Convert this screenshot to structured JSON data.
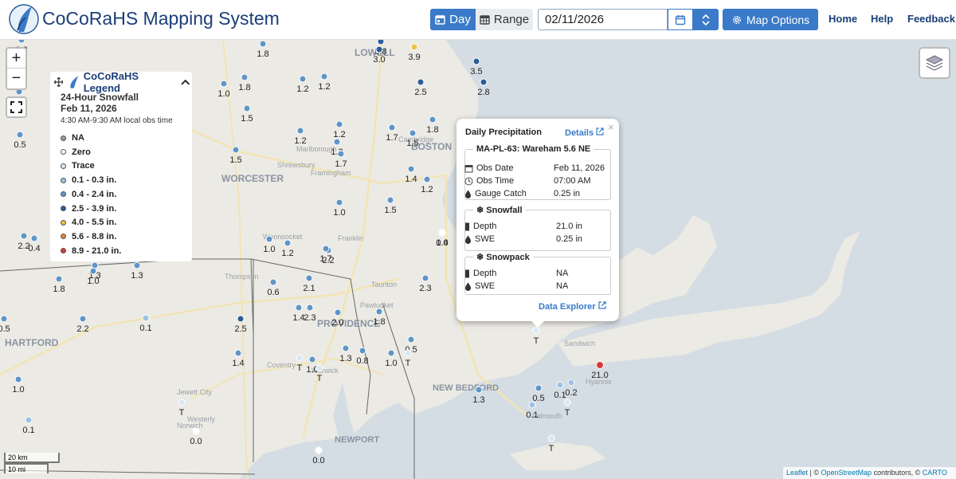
{
  "header": {
    "app_title": "CoCoRaHS Mapping System",
    "day_label": "Day",
    "range_label": "Range",
    "date_value": "02/11/2026",
    "map_options_label": "Map Options",
    "nav": [
      "Home",
      "Help",
      "Feedback"
    ]
  },
  "legend": {
    "title": "CoCoRaHS Legend",
    "subtitle": "24-Hour Snowfall",
    "date": "Feb 11, 2026",
    "obs_time": "4:30 AM-9:30 AM local obs time",
    "items": [
      {
        "label": "NA",
        "color": "#9a9a9a"
      },
      {
        "label": "Zero",
        "color": "#ffffff"
      },
      {
        "label": "Trace",
        "color": "#d9e8f5"
      },
      {
        "label": "0.1 - 0.3 in.",
        "color": "#9cc3e6"
      },
      {
        "label": "0.4 - 2.4 in.",
        "color": "#5f95c8"
      },
      {
        "label": "2.5 - 3.9 in.",
        "color": "#2a5d9a"
      },
      {
        "label": "4.0 - 5.5 in.",
        "color": "#e8c448"
      },
      {
        "label": "5.6 - 8.8 in.",
        "color": "#e08a3a"
      },
      {
        "label": "8.9 - 21.0 in.",
        "color": "#d93838"
      }
    ]
  },
  "popup": {
    "title": "Daily Precipitation",
    "details_label": "Details",
    "station": "MA-PL-63: Wareham 5.6 NE",
    "obs_date_label": "Obs Date",
    "obs_date": "Feb 11, 2026",
    "obs_time_label": "Obs Time",
    "obs_time": "07:00 AM",
    "gauge_label": "Gauge Catch",
    "gauge_catch": "0.25 in",
    "snowfall_title": "Snowfall",
    "snowfall_depth_label": "Depth",
    "snowfall_depth": "21.0 in",
    "snowfall_swe_label": "SWE",
    "snowfall_swe": "0.25 in",
    "snowpack_title": "Snowpack",
    "snowpack_depth_label": "Depth",
    "snowpack_depth": "NA",
    "snowpack_swe_label": "SWE",
    "snowpack_swe": "NA",
    "explorer_label": "Data Explorer"
  },
  "place_labels": [
    "LOWELL",
    "BOSTON",
    "WORCESTER",
    "PROVIDENCE",
    "HARTFORD",
    "NEW BEDFORD",
    "NEWPORT",
    "Framingham",
    "Marlborough",
    "Shrewsbury",
    "Franklin",
    "Thompson",
    "Coventry",
    "Warwick",
    "Westerly",
    "Norwich",
    "Jewett City",
    "Sandwich",
    "Hyannis",
    "Falmouth",
    "Plymouth",
    "Cambridge",
    "Taunton",
    "Woonsocket",
    "Pawtucket"
  ],
  "stations": [
    {
      "value": "1.8",
      "color": "#5f95c8"
    },
    {
      "value": "2.3",
      "color": "#5f95c8"
    },
    {
      "value": "3.8",
      "color": "#2a5d9a"
    },
    {
      "value": "3.0",
      "color": "#2a5d9a"
    },
    {
      "value": "3.9",
      "color": "#e8c448"
    },
    {
      "value": "3.5",
      "color": "#2a5d9a"
    },
    {
      "value": "2.5",
      "color": "#2a5d9a"
    },
    {
      "value": "2.8",
      "color": "#2a5d9a"
    },
    {
      "value": "1.0",
      "color": "#5f95c8"
    },
    {
      "value": "1.8",
      "color": "#5f95c8"
    },
    {
      "value": "1.2",
      "color": "#5f95c8"
    },
    {
      "value": "1.2",
      "color": "#5f95c8"
    },
    {
      "value": "1.5",
      "color": "#5f95c8"
    },
    {
      "value": "1.5",
      "color": "#5f95c8"
    },
    {
      "value": "1.2",
      "color": "#5f95c8"
    },
    {
      "value": "1.2",
      "color": "#5f95c8"
    },
    {
      "value": "1.3",
      "color": "#5f95c8"
    },
    {
      "value": "1.7",
      "color": "#5f95c8"
    },
    {
      "value": "1.5",
      "color": "#5f95c8"
    },
    {
      "value": "1.8",
      "color": "#5f95c8"
    },
    {
      "value": "0.5",
      "color": "#5f95c8"
    },
    {
      "value": "1.5",
      "color": "#5f95c8"
    },
    {
      "value": "1.7",
      "color": "#5f95c8"
    },
    {
      "value": "1.4",
      "color": "#5f95c8"
    },
    {
      "value": "1.2",
      "color": "#5f95c8"
    },
    {
      "value": "1.0",
      "color": "#5f95c8"
    },
    {
      "value": "1.5",
      "color": "#5f95c8"
    },
    {
      "value": "1.4",
      "color": "#5f95c8"
    },
    {
      "value": "2.2",
      "color": "#5f95c8"
    },
    {
      "value": "0.4",
      "color": "#5f95c8"
    },
    {
      "value": "1.0",
      "color": "#5f95c8"
    },
    {
      "value": "1.2",
      "color": "#5f95c8"
    },
    {
      "value": "1.7",
      "color": "#5f95c8"
    },
    {
      "value": "2.2",
      "color": "#5f95c8"
    },
    {
      "value": "1.3",
      "color": "#5f95c8"
    },
    {
      "value": "1.0",
      "color": "#5f95c8"
    },
    {
      "value": "1.3",
      "color": "#5f95c8"
    },
    {
      "value": "1.8",
      "color": "#5f95c8"
    },
    {
      "value": "0.6",
      "color": "#5f95c8"
    },
    {
      "value": "2.1",
      "color": "#5f95c8"
    },
    {
      "value": "2.3",
      "color": "#5f95c8"
    },
    {
      "value": "2.5",
      "color": "#2a5d9a"
    },
    {
      "value": "1.4",
      "color": "#5f95c8"
    },
    {
      "value": "2.3",
      "color": "#5f95c8"
    },
    {
      "value": "2.0",
      "color": "#5f95c8"
    },
    {
      "value": "1.8",
      "color": "#5f95c8"
    },
    {
      "value": "2.2",
      "color": "#5f95c8"
    },
    {
      "value": "0.1",
      "color": "#9cc3e6"
    },
    {
      "value": "0.5",
      "color": "#5f95c8"
    },
    {
      "value": "1.4",
      "color": "#5f95c8"
    },
    {
      "value": "0.5",
      "color": "#5f95c8"
    },
    {
      "value": "1.3",
      "color": "#5f95c8"
    },
    {
      "value": "0.8",
      "color": "#5f95c8"
    },
    {
      "value": "1.0",
      "color": "#5f95c8"
    },
    {
      "value": "T",
      "color": "#d9e8f5"
    },
    {
      "value": "T",
      "color": "#d9e8f5"
    },
    {
      "value": "1.0",
      "color": "#5f95c8"
    },
    {
      "value": "1.0",
      "color": "#5f95c8"
    },
    {
      "value": "T",
      "color": "#d9e8f5"
    },
    {
      "value": "T",
      "color": "#d9e8f5"
    },
    {
      "value": "21.0",
      "color": "#d93838"
    },
    {
      "value": "1.3",
      "color": "#5f95c8"
    },
    {
      "value": "0.5",
      "color": "#5f95c8"
    },
    {
      "value": "0.1",
      "color": "#9cc3e6"
    },
    {
      "value": "0.2",
      "color": "#9cc3e6"
    },
    {
      "value": "T",
      "color": "#d9e8f5"
    },
    {
      "value": "0.1",
      "color": "#9cc3e6"
    },
    {
      "value": "T",
      "color": "#d9e8f5"
    },
    {
      "value": "0.1",
      "color": "#9cc3e6"
    },
    {
      "value": "0.0",
      "color": "#ffffff"
    },
    {
      "value": "T",
      "color": "#d9e8f5"
    },
    {
      "value": "0.0",
      "color": "#ffffff"
    },
    {
      "value": "0.0",
      "color": "#ffffff"
    },
    {
      "value": "1.4",
      "color": "#5f95c8"
    }
  ],
  "scale": {
    "km": "20 km",
    "mi": "10 mi"
  },
  "attribution": {
    "leaflet": "Leaflet",
    "sep1": " | © ",
    "osm": "OpenStreetMap",
    "contrib": " contributors, © ",
    "carto": "CARTO"
  }
}
